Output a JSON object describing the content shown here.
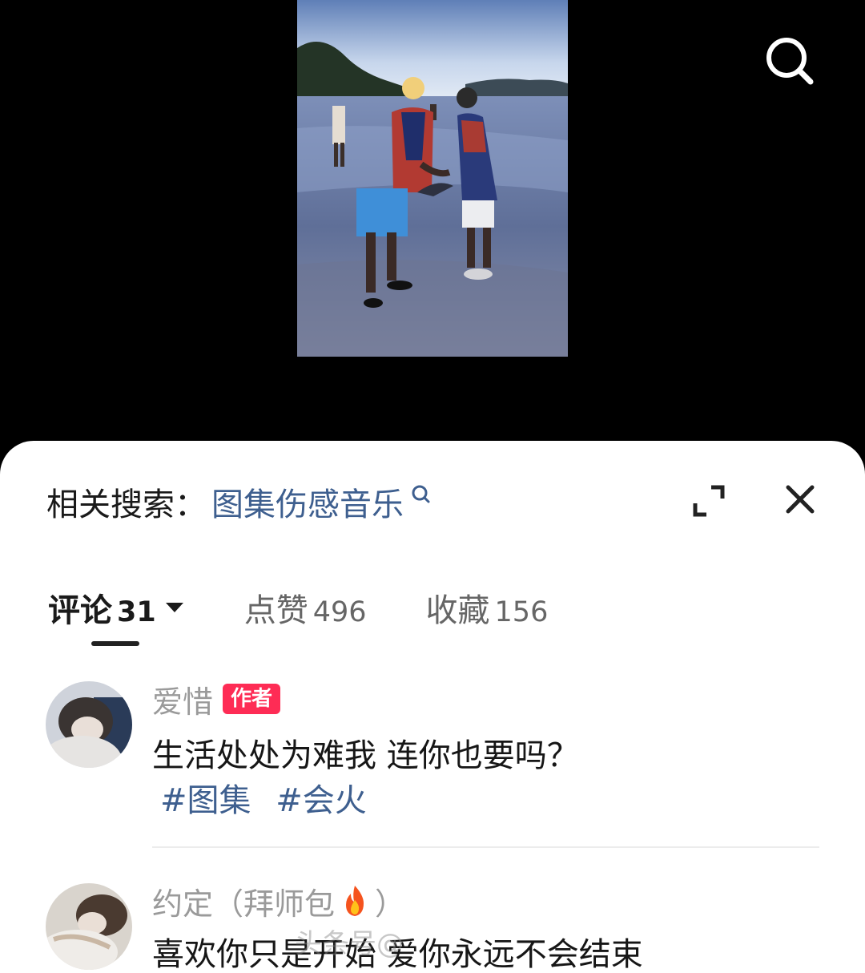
{
  "related_search": {
    "label": "相关搜索：",
    "term": "图集伤感音乐"
  },
  "tabs": [
    {
      "label": "评论",
      "count": "31"
    },
    {
      "label": "点赞",
      "count": "496"
    },
    {
      "label": "收藏",
      "count": "156"
    }
  ],
  "comments": [
    {
      "author": "爱惜",
      "badge": "作者",
      "text": "生活处处为难我 连你也要吗？",
      "hashtags": [
        "#图集",
        "#会火"
      ]
    },
    {
      "author": "约定",
      "author_suffix_open": "（拜师包",
      "author_suffix_close": "）",
      "text": "喜欢你只是开始 爱你永远不会结束"
    }
  ],
  "watermark": "头条号@",
  "icons": {
    "top_search": "search-icon",
    "related": "search-icon",
    "expand": "expand-icon",
    "close": "close-icon",
    "tab_caret": "caret-down-icon",
    "fire": "fire-icon"
  },
  "colors": {
    "link_blue": "#3e5f8f",
    "badge_red": "#fe2c55",
    "sheet_bg": "#ffffff",
    "top_bg": "#000000"
  }
}
